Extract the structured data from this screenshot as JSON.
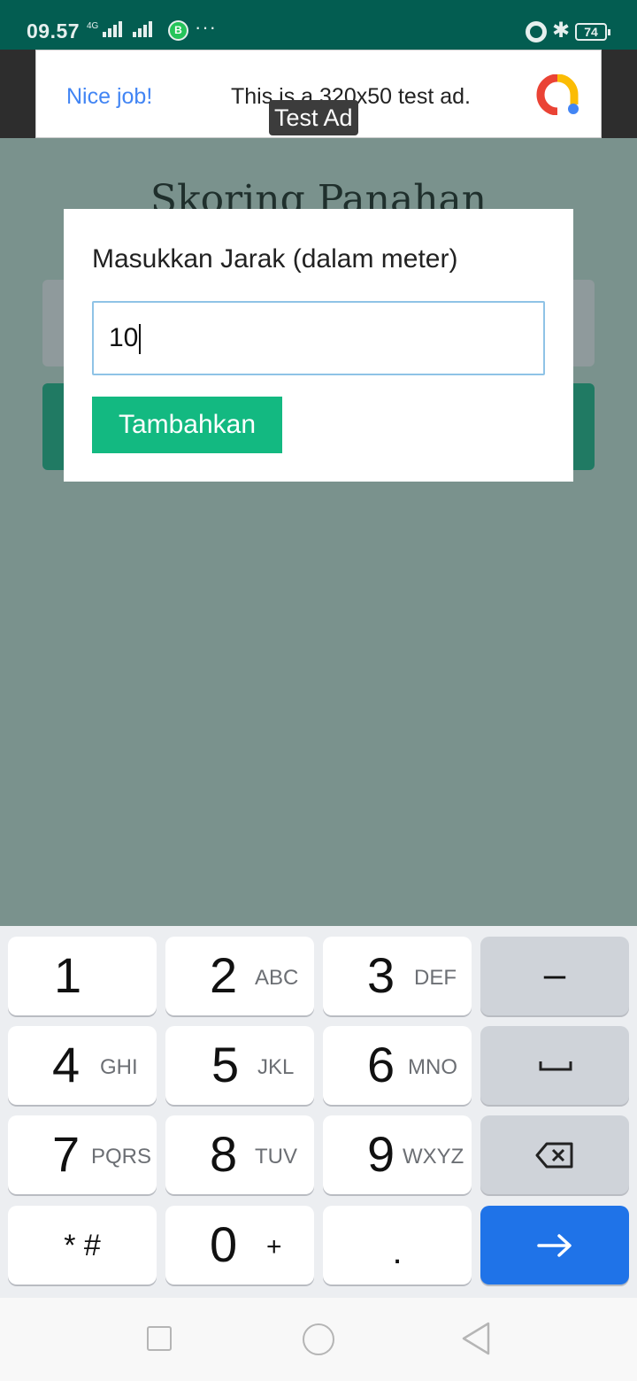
{
  "status_bar": {
    "time": "09.57",
    "network": "4G",
    "battery": "74"
  },
  "ad": {
    "label": "Test Ad",
    "headline": "Nice job!",
    "body": "This is a 320x50 test ad."
  },
  "app": {
    "title": "Skoring Panahan"
  },
  "dialog": {
    "title": "Masukkan Jarak (dalam meter)",
    "input_value": "10",
    "submit_label": "Tambahkan"
  },
  "keyboard": {
    "rows": [
      [
        {
          "digit": "1",
          "letters": ""
        },
        {
          "digit": "2",
          "letters": "ABC"
        },
        {
          "digit": "3",
          "letters": "DEF"
        },
        {
          "symbol": "–"
        }
      ],
      [
        {
          "digit": "4",
          "letters": "GHI"
        },
        {
          "digit": "5",
          "letters": "JKL"
        },
        {
          "digit": "6",
          "letters": "MNO"
        },
        {
          "symbol": "space"
        }
      ],
      [
        {
          "digit": "7",
          "letters": "PQRS"
        },
        {
          "digit": "8",
          "letters": "TUV"
        },
        {
          "digit": "9",
          "letters": "WXYZ"
        },
        {
          "symbol": "backspace"
        }
      ],
      [
        {
          "symbol": "* #"
        },
        {
          "digit": "0",
          "letters": "+"
        },
        {
          "symbol": "."
        },
        {
          "symbol": "enter"
        }
      ]
    ],
    "key_1": {
      "digit": "1"
    },
    "key_2": {
      "digit": "2",
      "letters": "ABC"
    },
    "key_3": {
      "digit": "3",
      "letters": "DEF"
    },
    "key_4": {
      "digit": "4",
      "letters": "GHI"
    },
    "key_5": {
      "digit": "5",
      "letters": "JKL"
    },
    "key_6": {
      "digit": "6",
      "letters": "MNO"
    },
    "key_7": {
      "digit": "7",
      "letters": "PQRS"
    },
    "key_8": {
      "digit": "8",
      "letters": "TUV"
    },
    "key_9": {
      "digit": "9",
      "letters": "WXYZ"
    },
    "key_0": {
      "digit": "0",
      "letters": "+"
    },
    "key_minus": "–",
    "key_star_hash": "* #",
    "key_dot": ".",
    "enter_color": "#1f73e8"
  },
  "colors": {
    "status_bar": "#035d51",
    "background_overlay": "#7a928d",
    "primary_button": "#13b981",
    "input_border": "#8fc3e6"
  }
}
